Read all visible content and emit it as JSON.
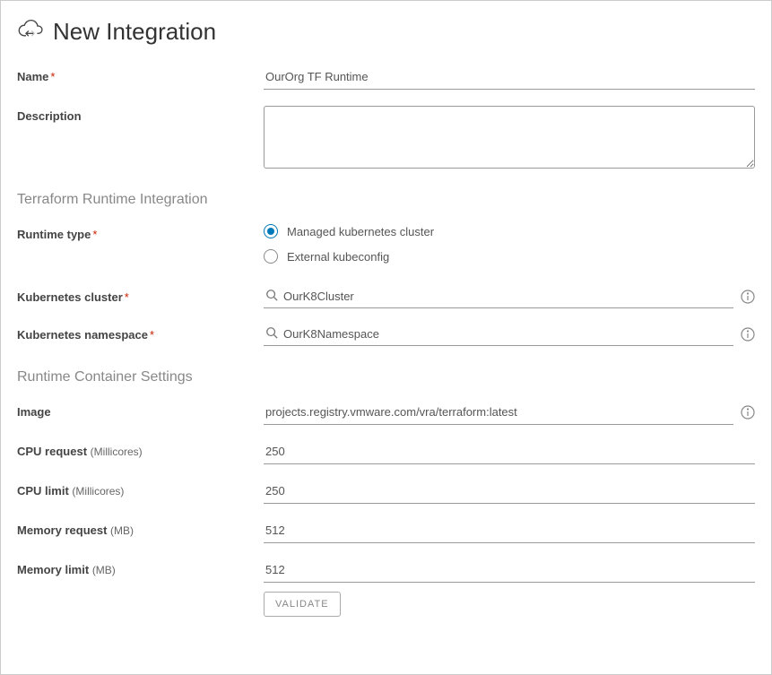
{
  "page": {
    "title": "New Integration"
  },
  "fields": {
    "name": {
      "label": "Name",
      "value": "OurOrg TF Runtime"
    },
    "description": {
      "label": "Description",
      "value": ""
    }
  },
  "sections": {
    "runtime_integration": "Terraform Runtime Integration",
    "container_settings": "Runtime Container Settings"
  },
  "runtime": {
    "type_label": "Runtime type",
    "options": {
      "managed": "Managed kubernetes cluster",
      "external": "External kubeconfig"
    },
    "cluster": {
      "label": "Kubernetes cluster",
      "value": "OurK8Cluster"
    },
    "namespace": {
      "label": "Kubernetes namespace",
      "value": "OurK8Namespace"
    }
  },
  "container": {
    "image": {
      "label": "Image",
      "value": "projects.registry.vmware.com/vra/terraform:latest"
    },
    "cpu_request": {
      "label": "CPU request",
      "unit": "(Millicores)",
      "value": "250"
    },
    "cpu_limit": {
      "label": "CPU limit",
      "unit": "(Millicores)",
      "value": "250"
    },
    "mem_request": {
      "label": "Memory request",
      "unit": "(MB)",
      "value": "512"
    },
    "mem_limit": {
      "label": "Memory limit",
      "unit": "(MB)",
      "value": "512"
    }
  },
  "buttons": {
    "validate": "VALIDATE"
  }
}
